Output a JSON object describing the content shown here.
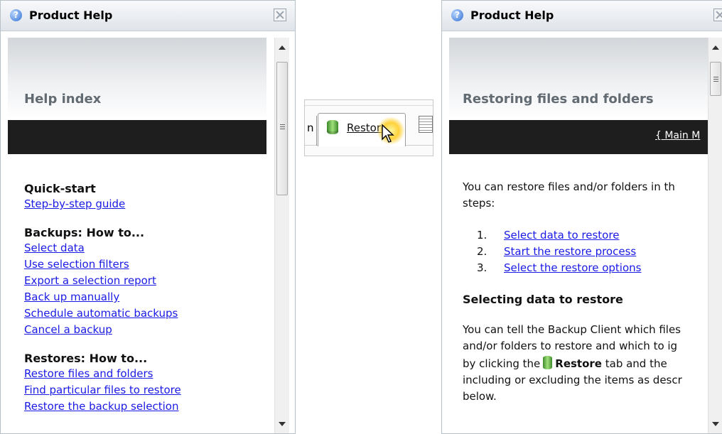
{
  "left_panel": {
    "title": "Product Help",
    "header_title": "Help index",
    "sections": [
      {
        "title": "Quick-start",
        "links": [
          "Step-by-step guide"
        ]
      },
      {
        "title": "Backups: How to...",
        "links": [
          "Select data",
          "Use selection filters",
          "Export a selection report",
          "Back up manually",
          "Schedule automatic backups",
          "Cancel a backup"
        ]
      },
      {
        "title": "Restores: How to...",
        "links": [
          "Restore files and folders",
          "Find particular files to restore",
          "Restore the backup selection"
        ]
      }
    ]
  },
  "tab_strip": {
    "prev_tab_fragment": "n",
    "restore_tab_label": "Restore"
  },
  "right_panel": {
    "title": "Product Help",
    "header_title": "Restoring files and folders",
    "menu_link": "{ Main M",
    "intro": [
      "You can restore files and/or folders in th",
      "steps:"
    ],
    "steps": [
      {
        "num": "1.",
        "text": "Select data to restore"
      },
      {
        "num": "2.",
        "text": "Start the restore process"
      },
      {
        "num": "3.",
        "text": "Select the restore options"
      }
    ],
    "section_title": "Selecting data to restore",
    "body_lines": [
      "You can tell the Backup Client which files",
      "and/or folders to restore and which to ig"
    ],
    "body_line3_prefix": "by clicking the",
    "body_line3_bold": "Restore",
    "body_line3_suffix": "tab and the",
    "body_line4": "including or excluding the items as descr",
    "body_line5": "below."
  },
  "icons": {
    "help": "question-mark-icon",
    "close": "close-icon",
    "database": "database-icon",
    "cursor": "mouse-pointer-icon",
    "document": "document-icon"
  }
}
